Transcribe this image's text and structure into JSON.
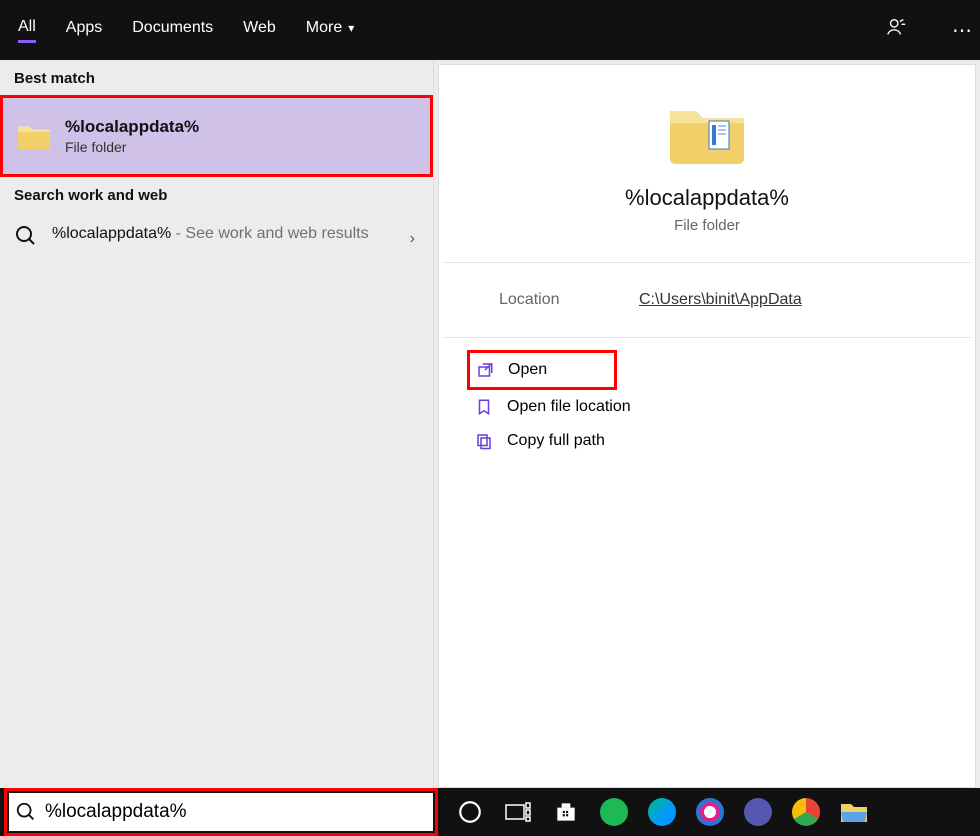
{
  "tabs": {
    "all": "All",
    "apps": "Apps",
    "documents": "Documents",
    "web": "Web",
    "more": "More"
  },
  "left": {
    "best_match_label": "Best match",
    "best_title": "%localappdata%",
    "best_sub": "File folder",
    "search_web_label": "Search work and web",
    "web_term": "%localappdata%",
    "web_tail": " - See work and web results"
  },
  "preview": {
    "title": "%localappdata%",
    "sub": "File folder",
    "location_label": "Location",
    "location_val": "C:\\Users\\binit\\AppData",
    "actions": {
      "open": "Open",
      "open_loc": "Open file location",
      "copy_path": "Copy full path"
    }
  },
  "search": {
    "value": "%localappdata%"
  }
}
